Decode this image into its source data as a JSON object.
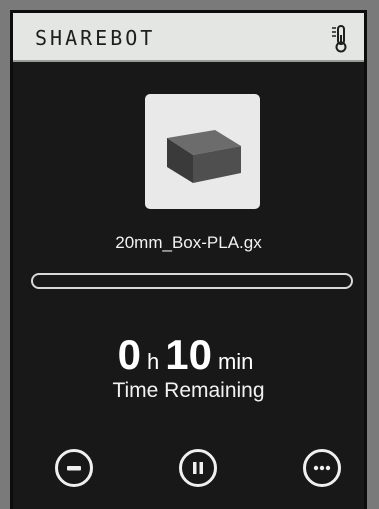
{
  "header": {
    "brand": "SHAREBOT",
    "temperature_icon": "thermometer-icon"
  },
  "job": {
    "thumbnail_icon": "box-preview-icon",
    "filename": "20mm_Box-PLA.gx",
    "progress": 0
  },
  "time_remaining": {
    "hours": "0",
    "hours_unit": "h",
    "minutes": "10",
    "minutes_unit": "min",
    "label": "Time Remaining"
  },
  "controls": [
    {
      "name": "decrease-button",
      "icon": "minus-icon"
    },
    {
      "name": "pause-button",
      "icon": "pause-icon"
    },
    {
      "name": "more-button",
      "icon": "ellipsis-icon"
    }
  ],
  "colors": {
    "header_bg": "#e4e6e3",
    "screen_bg": "#181818",
    "text": "#f2f2f2"
  }
}
